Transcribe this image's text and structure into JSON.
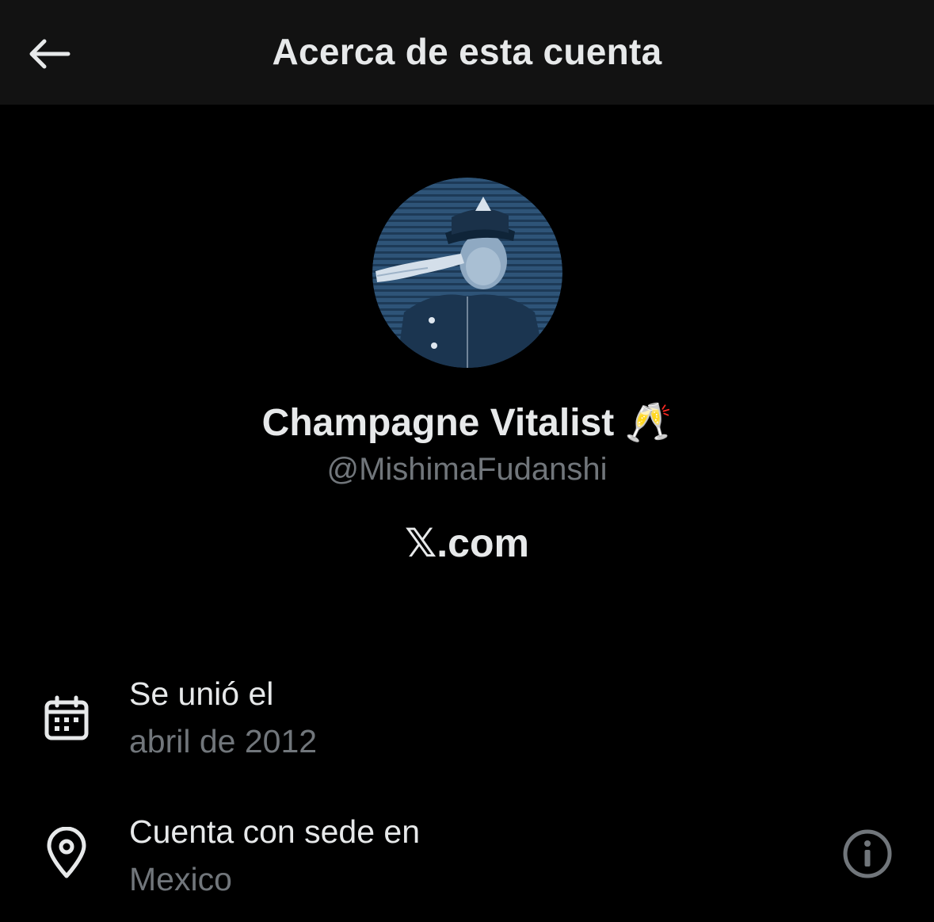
{
  "header": {
    "title": "Acerca de esta cuenta",
    "back_icon": "arrow-left-icon"
  },
  "profile": {
    "display_name": "Champagne Vitalist",
    "display_name_emoji": "🥂",
    "handle": "@MishimaFudanshi",
    "site": "𝕏.com",
    "avatar_description_icon": "avatar-photo"
  },
  "details": [
    {
      "icon": "calendar-icon",
      "label": "Se unió el",
      "value": "abril de 2012"
    },
    {
      "icon": "location-pin-icon",
      "label": "Cuenta con sede en",
      "value": "Mexico",
      "action_icon": "info-icon"
    }
  ],
  "colors": {
    "background": "#000000",
    "header_background": "#121212",
    "primary_text": "#e7e9ea",
    "secondary_text": "#71767b",
    "avatar_tint": "#2c4d6e"
  }
}
